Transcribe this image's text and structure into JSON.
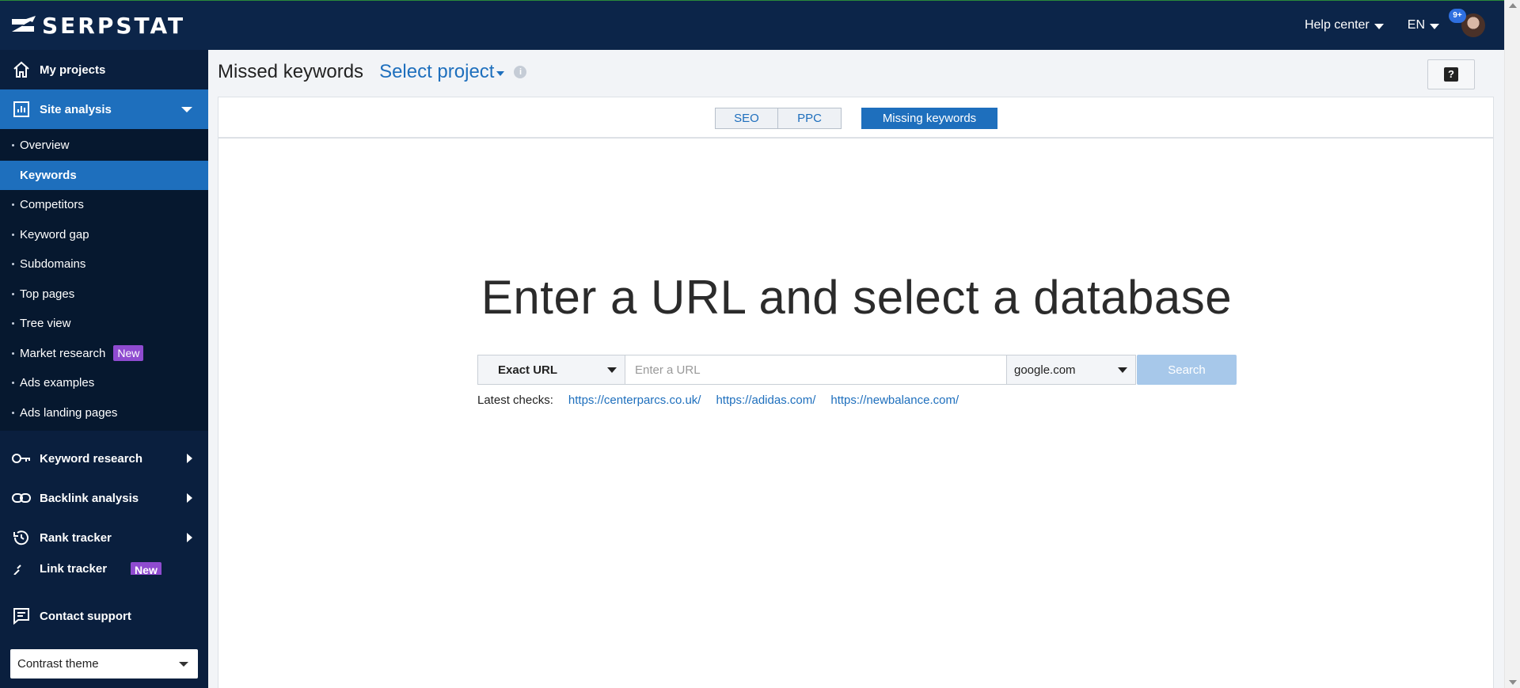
{
  "header": {
    "logo_text": "SERPSTAT",
    "help_center": "Help center",
    "language": "EN",
    "notifications_badge": "9+"
  },
  "sidebar": {
    "my_projects": "My projects",
    "site_analysis": "Site analysis",
    "site_items": [
      {
        "label": "Overview"
      },
      {
        "label": "Keywords"
      },
      {
        "label": "Competitors"
      },
      {
        "label": "Keyword gap"
      },
      {
        "label": "Subdomains"
      },
      {
        "label": "Top pages"
      },
      {
        "label": "Tree view"
      },
      {
        "label": "Market research",
        "badge": "New"
      },
      {
        "label": "Ads examples"
      },
      {
        "label": "Ads landing pages"
      }
    ],
    "keyword_research": "Keyword research",
    "backlink_analysis": "Backlink analysis",
    "rank_tracker": "Rank tracker",
    "link_tracker": "Link tracker",
    "link_tracker_badge": "New",
    "contact_support": "Contact support",
    "theme_select": "Contrast theme"
  },
  "page": {
    "title": "Missed keywords",
    "project_select": "Select project",
    "help_button": "?"
  },
  "tabs": {
    "seo": "SEO",
    "ppc": "PPC",
    "missing": "Missing keywords"
  },
  "main": {
    "hero": "Enter a URL and select a database",
    "search_type": "Exact URL",
    "url_placeholder": "Enter a URL",
    "database": "google.com",
    "search_button": "Search",
    "latest_label": "Latest checks:",
    "latest_links": [
      "https://centerparcs.co.uk/",
      "https://adidas.com/",
      "https://newbalance.com/"
    ]
  },
  "colors": {
    "topbar": "#0c2549",
    "sidebar": "#0a1f3e",
    "accent": "#1e6fbd",
    "new_badge": "#8f4bd0"
  }
}
